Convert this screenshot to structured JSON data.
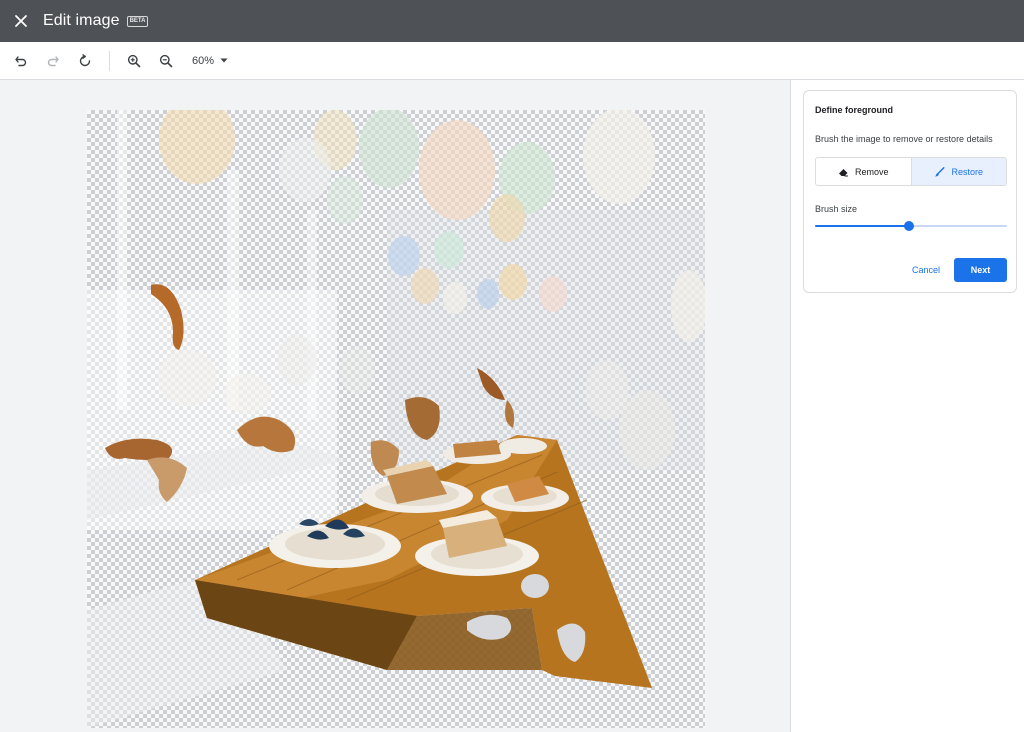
{
  "header": {
    "title": "Edit image",
    "badge": "BETA",
    "close_icon": "close-icon"
  },
  "toolbar": {
    "icons": [
      "undo-icon",
      "redo-icon",
      "reset-icon",
      "zoom-in-icon",
      "zoom-out-icon"
    ],
    "zoom_level": "60%"
  },
  "panel": {
    "title": "Define foreground",
    "description": "Brush the image to remove or restore details",
    "modes": [
      {
        "label": "Remove",
        "icon": "eraser-icon",
        "selected": false
      },
      {
        "label": "Restore",
        "icon": "brush-icon",
        "selected": true
      }
    ],
    "brush_size_label": "Brush size",
    "brush_size_fraction": 0.49,
    "cancel_label": "Cancel",
    "next_label": "Next"
  },
  "colors": {
    "header_bg": "#4e5256",
    "accent": "#1a73e8",
    "canvas_bg": "#f1f3f4"
  }
}
